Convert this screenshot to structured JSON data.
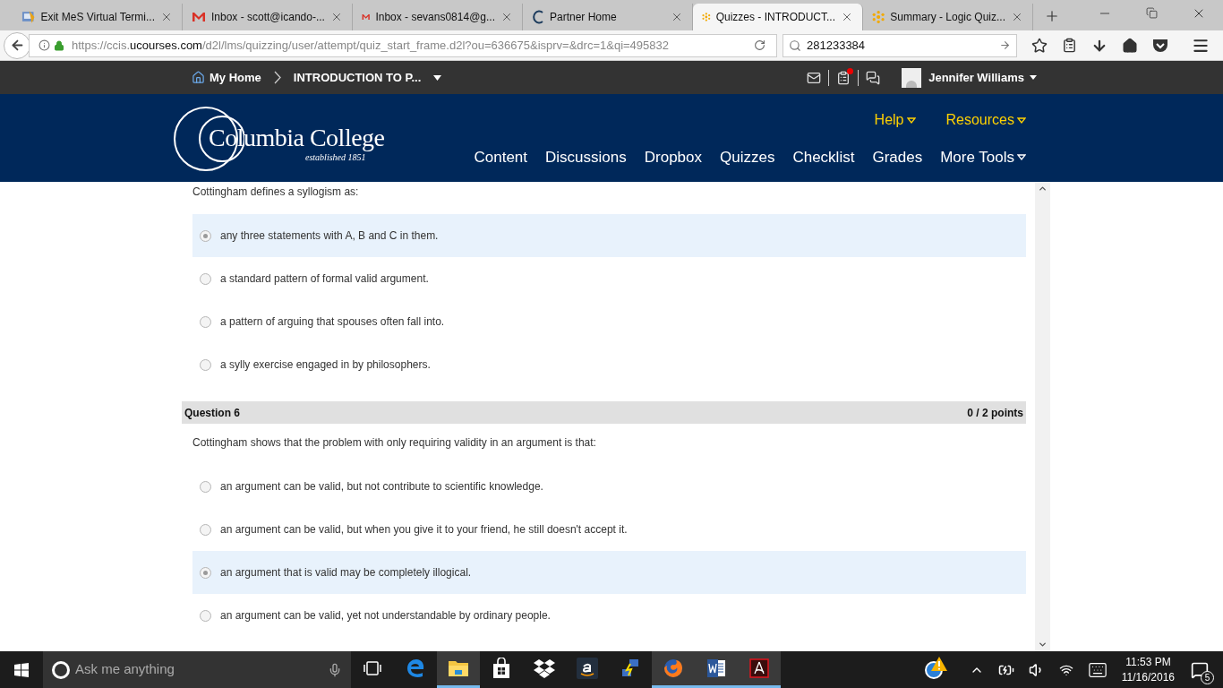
{
  "browser": {
    "tabs": [
      {
        "title": "Exit MeS Virtual Termi...",
        "kind": "terminal",
        "selected": false
      },
      {
        "title": "Inbox - scott@icando-...",
        "kind": "mail",
        "selected": false
      },
      {
        "title": "Inbox - sevans0814@g...",
        "kind": "mail",
        "selected": false
      },
      {
        "title": "Partner Home",
        "kind": "partner",
        "selected": false
      },
      {
        "title": "Quizzes - INTRODUCT...",
        "kind": "quiz",
        "selected": true
      },
      {
        "title": "Summary - Logic Quiz...",
        "kind": "quiz",
        "selected": false
      }
    ],
    "url": {
      "prefix": "https://ccis.",
      "domain": "ucourses.com",
      "path": "/d2l/lms/quizzing/user/attempt/quiz_start_frame.d2l?ou=636675&isprv=&drc=1&qi=495832"
    },
    "search": {
      "value": "281233384"
    }
  },
  "minibar": {
    "home": "My Home",
    "course": "INTRODUCTION TO P...",
    "user": "Jennifer Williams",
    "updates_alert": true
  },
  "banner": {
    "logo": {
      "name": "Columbia College",
      "tagline": "established 1851"
    },
    "links": [
      "Help",
      "Resources"
    ],
    "nav": [
      {
        "label": "Content",
        "menu": false
      },
      {
        "label": "Discussions",
        "menu": false
      },
      {
        "label": "Dropbox",
        "menu": false
      },
      {
        "label": "Quizzes",
        "menu": false
      },
      {
        "label": "Checklist",
        "menu": false
      },
      {
        "label": "Grades",
        "menu": false
      },
      {
        "label": "More Tools",
        "menu": true
      }
    ]
  },
  "questions": [
    {
      "prompt": "Cottingham defines a syllogism as:",
      "choices": [
        {
          "text": "any three statements with A, B and C in them.",
          "selected": true
        },
        {
          "text": "a standard pattern of formal valid argument.",
          "selected": false
        },
        {
          "text": "a pattern of arguing that spouses often fall into.",
          "selected": false
        },
        {
          "text": "a sylly exercise engaged in by philosophers.",
          "selected": false
        }
      ]
    },
    {
      "title": "Question 6",
      "score": "0 / 2 points",
      "prompt": "Cottingham shows that the problem with only requiring validity in an argument is that:",
      "choices": [
        {
          "text": "an argument can be valid, but not contribute to scientific knowledge.",
          "selected": false
        },
        {
          "text": "an argument can be valid, but when you give it to your friend, he still doesn't accept it.",
          "selected": false
        },
        {
          "text": "an argument that is valid may be completely illogical.",
          "selected": true
        },
        {
          "text": "an argument can be valid, yet not understandable by ordinary people.",
          "selected": false
        }
      ]
    }
  ],
  "taskbar": {
    "search": {
      "placeholder": "Ask me anything"
    },
    "apps": [
      {
        "kind": "taskview",
        "active": false
      },
      {
        "kind": "edge",
        "active": false
      },
      {
        "kind": "explorer",
        "active": true
      },
      {
        "kind": "store",
        "active": false
      },
      {
        "kind": "dropbox",
        "active": false
      },
      {
        "kind": "amazon",
        "active": false
      },
      {
        "kind": "network",
        "active": false
      },
      {
        "kind": "firefox",
        "active": true
      },
      {
        "kind": "word",
        "active": true
      },
      {
        "kind": "acrobat",
        "active": true
      }
    ],
    "time": "11:53 PM",
    "date": "11/16/2016",
    "notifications": "5"
  }
}
